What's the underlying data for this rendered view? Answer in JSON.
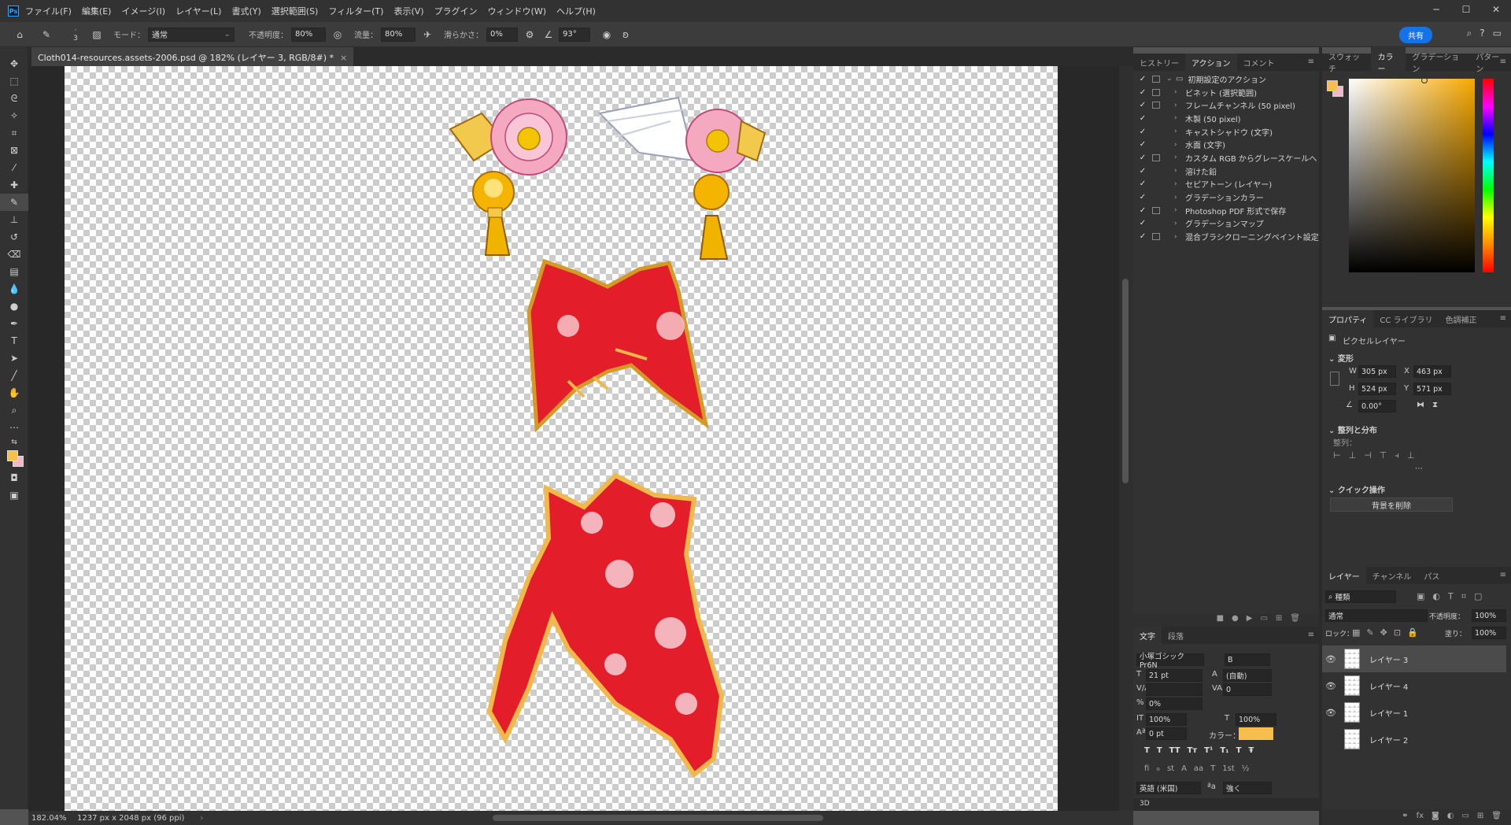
{
  "menu": [
    "ファイル(F)",
    "編集(E)",
    "イメージ(I)",
    "レイヤー(L)",
    "書式(Y)",
    "選択範囲(S)",
    "フィルター(T)",
    "表示(V)",
    "プラグイン",
    "ウィンドウ(W)",
    "ヘルプ(H)"
  ],
  "options": {
    "brush_size": "3",
    "mode_label": "モード：",
    "mode_value": "通常",
    "opacity_label": "不透明度：",
    "opacity_value": "80%",
    "flow_label": "流量：",
    "flow_value": "80%",
    "smooth_label": "滑らかさ：",
    "smooth_value": "0%",
    "angle_value": "93°",
    "share_label": "共有"
  },
  "document": {
    "tab_title": "Cloth014-resources.assets-2006.psd @ 182% (レイヤー 3, RGB/8#) *",
    "zoom": "182.04%",
    "size_info": "1237 px x 2048 px (96 ppi)"
  },
  "actions_panel": {
    "tabs": [
      "ヒストリー",
      "アクション",
      "コメント"
    ],
    "active_tab": "アクション",
    "set_name": "初期設定のアクション",
    "items": [
      {
        "name": "ビネット (選択範囲)",
        "dialog": true
      },
      {
        "name": "フレームチャンネル (50 pixel)",
        "dialog": true
      },
      {
        "name": "木製 (50 pixel)",
        "dialog": false
      },
      {
        "name": "キャストシャドウ (文字)",
        "dialog": false
      },
      {
        "name": "水面 (文字)",
        "dialog": false
      },
      {
        "name": "カスタム RGB からグレースケールへ",
        "dialog": true
      },
      {
        "name": "溶けた鉛",
        "dialog": false
      },
      {
        "name": "セピアトーン (レイヤー)",
        "dialog": false
      },
      {
        "name": "グラデーションカラー",
        "dialog": false
      },
      {
        "name": "Photoshop PDF 形式で保存",
        "dialog": true
      },
      {
        "name": "グラデーションマップ",
        "dialog": false
      },
      {
        "name": "混合ブラシクローニングペイント設定",
        "dialog": true
      }
    ]
  },
  "color_panel": {
    "tabs": [
      "スウォッチ",
      "カラー",
      "グラデーション",
      "パターン"
    ],
    "active_tab": "カラー",
    "foreground": "#f7be4e",
    "background": "#f3b7c7"
  },
  "properties_panel": {
    "tabs": [
      "プロパティ",
      "CC ライブラリ",
      "色調補正"
    ],
    "active_tab": "プロパティ",
    "layer_type": "ピクセルレイヤー",
    "transform_title": "変形",
    "w_label": "W",
    "w": "305 px",
    "h_label": "H",
    "h": "524 px",
    "x_label": "X",
    "x": "463 px",
    "y_label": "Y",
    "y": "571 px",
    "angle": "0.00°",
    "align_title": "整列と分布",
    "align_label": "整列：",
    "quick_title": "クイック操作",
    "remove_bg": "背景を削除"
  },
  "character_panel": {
    "tabs": [
      "文字",
      "段落"
    ],
    "active_tab": "文字",
    "font": "小塚ゴシック Pr6N",
    "style": "B",
    "size": "21 pt",
    "leading": "(自動)",
    "tracking": "0",
    "kerning": "",
    "tsume": "0%",
    "v_scale": "100%",
    "h_scale": "100%",
    "baseline": "0 pt",
    "color_label": "カラー：",
    "text_color": "#f7be4e",
    "language": "英語 (米国)",
    "aa_label": "ªa",
    "antialias": "強く",
    "glyph_buttons": [
      "T",
      "T",
      "TT",
      "Tт",
      "T¹",
      "T₁",
      "T",
      "Ŧ"
    ],
    "ot_buttons": [
      "fi",
      "ℴ",
      "st",
      "A",
      "aa",
      "T",
      "1st",
      "½"
    ],
    "threed_label": "3D"
  },
  "layers_panel": {
    "tabs": [
      "レイヤー",
      "チャンネル",
      "パス"
    ],
    "active_tab": "レイヤー",
    "filter_kind": "種類",
    "blend_mode": "通常",
    "opacity_label": "不透明度：",
    "opacity": "100%",
    "lock_label": "ロック：",
    "fill_label": "塗り：",
    "fill": "100%",
    "layers": [
      {
        "name": "レイヤー 3",
        "visible": true,
        "selected": true
      },
      {
        "name": "レイヤー 4",
        "visible": true,
        "selected": false
      },
      {
        "name": "レイヤー 1",
        "visible": true,
        "selected": false
      },
      {
        "name": "レイヤー 2",
        "visible": false,
        "selected": false
      }
    ]
  },
  "icons": [
    "home-icon",
    "brush-icon",
    "move-icon",
    "marquee-icon",
    "lasso-icon",
    "magic-wand-icon",
    "crop-icon",
    "frame-icon",
    "eyedropper-icon",
    "healing-icon",
    "brush-tool-icon",
    "stamp-icon",
    "history-brush-icon",
    "eraser-icon",
    "gradient-icon",
    "blur-icon",
    "dodge-icon",
    "pen-icon",
    "type-icon",
    "path-select-icon",
    "line-icon",
    "hand-icon",
    "zoom-icon",
    "more-icon",
    "search-icon",
    "help-icon",
    "eye-icon",
    "link-icon",
    "fx-icon",
    "mask-icon",
    "new-layer-icon",
    "trash-icon"
  ]
}
